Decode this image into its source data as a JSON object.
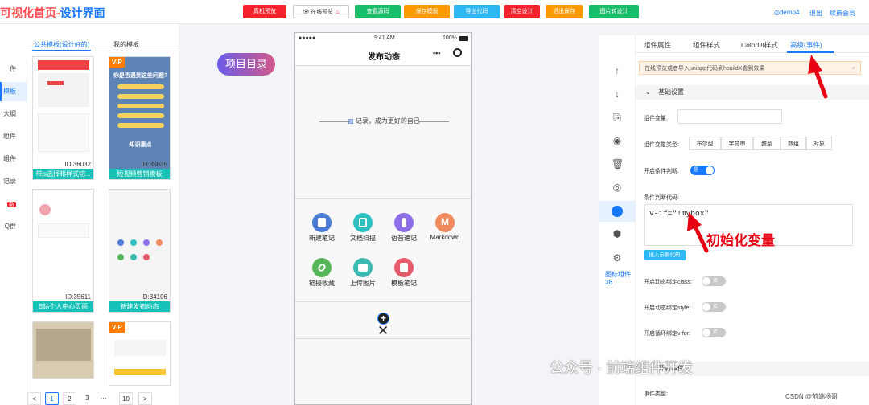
{
  "header": {
    "logo_red": "可视化首页-",
    "logo_blue": "设计界面",
    "buttons": [
      {
        "label": "真机预览",
        "color": "#f5222d"
      },
      {
        "label": "在线预览",
        "color": "#ffffff"
      },
      {
        "label": "查看源码",
        "color": "#19be6b"
      },
      {
        "label": "保存模板",
        "color": "#ff9900"
      },
      {
        "label": "导出代码",
        "color": "#2db7f5"
      },
      {
        "label": "清空设计",
        "color": "#f5222d"
      },
      {
        "label": "退出保存",
        "color": "#ff9900"
      },
      {
        "label": "图片转设计",
        "color": "#19be6b"
      }
    ],
    "user": "demo4",
    "logout": "退出",
    "renew": "续费会员"
  },
  "left": {
    "nav_items": [
      {
        "label": "件"
      },
      {
        "label": "模板"
      },
      {
        "label": "大纲"
      },
      {
        "label": "组件"
      },
      {
        "label": "组件"
      },
      {
        "label": "记录"
      },
      {
        "label": "新"
      },
      {
        "label": "Q群"
      }
    ],
    "tabs": [
      "公共模板(设计好的)",
      "我的模板"
    ],
    "templates": [
      {
        "id": "ID:36032",
        "name": "带js选择和样式切..."
      },
      {
        "id": "ID:35635",
        "name": "短视频营销模板",
        "vip": "VIP",
        "q": "你是否遇到这些问题?",
        "sub": "知识重点"
      },
      {
        "id": "ID:35611",
        "name": "B站个人中心页面"
      },
      {
        "id": "ID:34106",
        "name": "新建发布动态"
      },
      {
        "id": "",
        "name": ""
      },
      {
        "id": "",
        "name": "",
        "vip": "VIP"
      }
    ],
    "pager": [
      "<",
      "1",
      "2",
      "3",
      "···",
      "10",
      ">"
    ]
  },
  "center": {
    "dir_badge": "项目目录",
    "status_left": "●●●●● ",
    "status_time": "9:41 AM",
    "status_right": "100%",
    "nav_title": "发布动态",
    "nav_menu": "•••",
    "slogan": "记录，成为更好的自己",
    "apps": [
      {
        "label": "新建笔记",
        "color": "#4a7bd6",
        "glyph": "▤"
      },
      {
        "label": "文档扫描",
        "color": "#2bbfbf",
        "glyph": "⌗"
      },
      {
        "label": "语音速记",
        "color": "#8b6ee8",
        "glyph": "●"
      },
      {
        "label": "Markdown",
        "color": "#f08a5d",
        "glyph": "M"
      },
      {
        "label": "链接收藏",
        "color": "#58b65a",
        "glyph": "∞"
      },
      {
        "label": "上传图片",
        "color": "#3cb9b1",
        "glyph": "▦"
      },
      {
        "label": "模板笔记",
        "color": "#e55a6a",
        "glyph": "▣"
      }
    ]
  },
  "right": {
    "tabs": [
      "组件属性",
      "组件样式",
      "ColorUI样式",
      "高级(事件)"
    ],
    "warning": "在线预览或者导入uniapp代码到hbuildX看到效果",
    "section": "基础设置",
    "fields": {
      "var_label": "组件变量:",
      "type_label": "组件变量类型:",
      "types": [
        "布尔型",
        "字符串",
        "整型",
        "数组",
        "对象"
      ],
      "cond_label": "开启条件判断:",
      "cond_switch": "是",
      "code_label": "条件判断代码:",
      "code": "v-if=\"!mybox\"",
      "example_btn": "插入示例代码",
      "class_label": "开启动态绑定class:",
      "style_label": "开启动态绑定style:",
      "vfor_label": "开启循环绑定v-for:",
      "off": "否",
      "event_section": "开启事件",
      "event_type": "事件类型:"
    },
    "side_icon_label": "图标组件36",
    "annotation": "初始化变量"
  },
  "watermark": "公众号 · 前端组件开发",
  "credit": "CSDN @前端杨哥"
}
